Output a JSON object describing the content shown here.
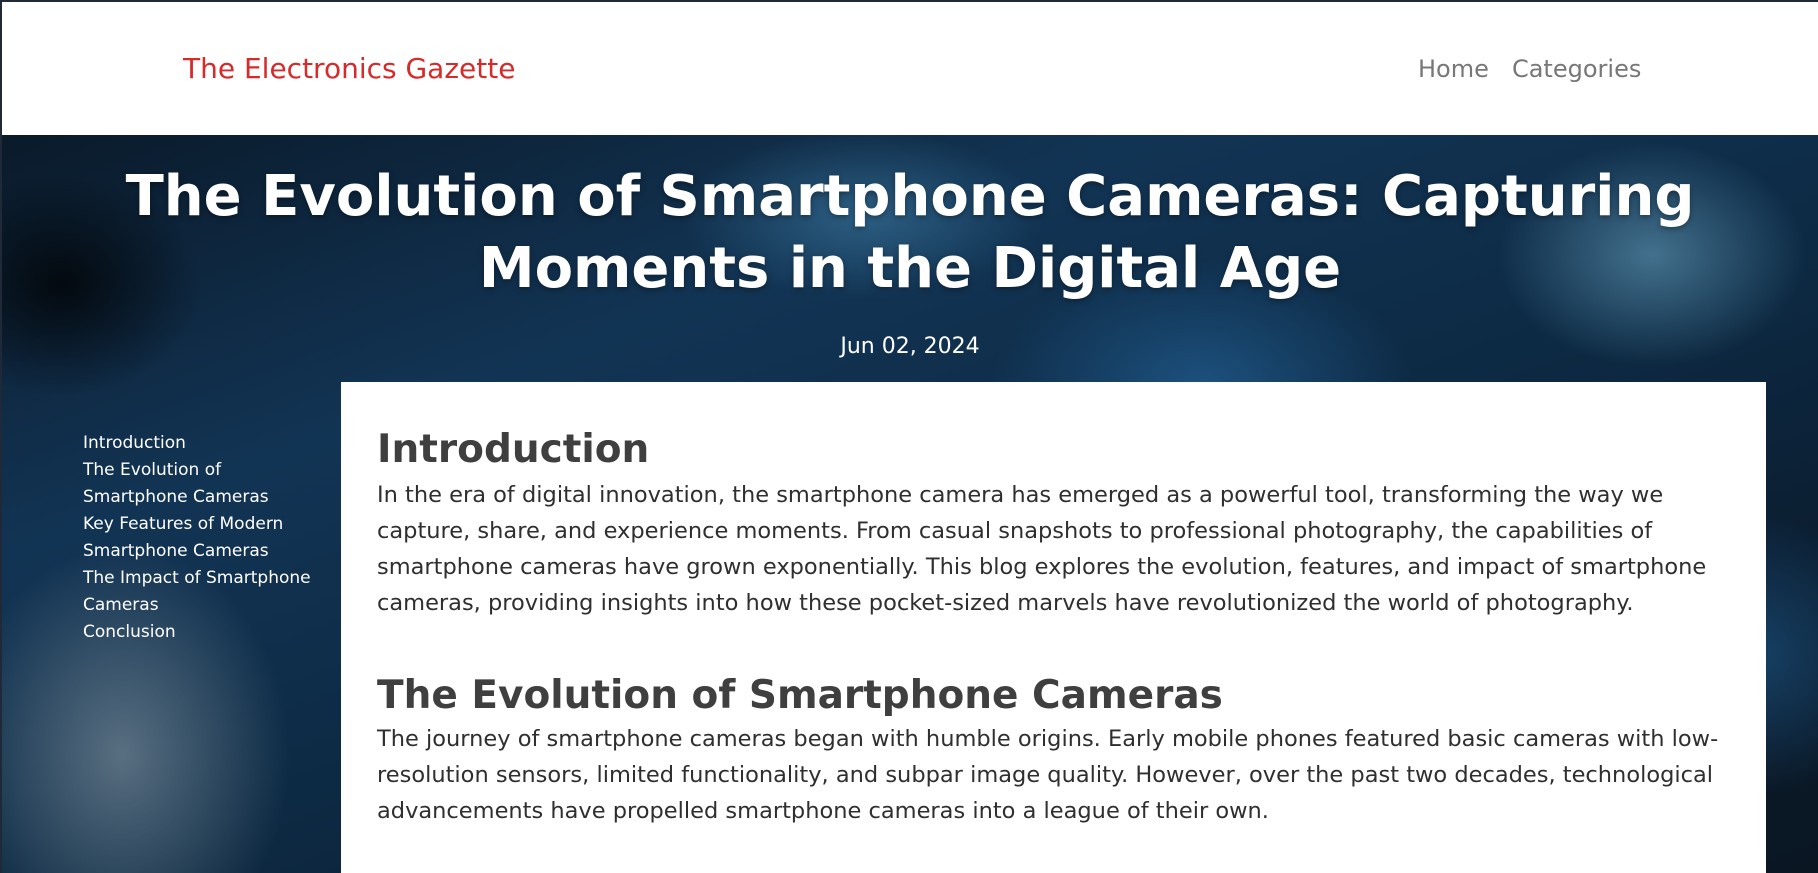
{
  "site": {
    "brand": "The Electronics Gazette",
    "nav": [
      "Home",
      "Categories"
    ]
  },
  "hero": {
    "title": "The Evolution of Smartphone Cameras: Capturing Moments in the Digital Age",
    "date": "Jun 02, 2024"
  },
  "toc": {
    "items": [
      "Introduction",
      "The Evolution of Smartphone Cameras",
      "Key Features of Modern Smartphone Cameras",
      "The Impact of Smartphone Cameras",
      "Conclusion"
    ]
  },
  "article": {
    "sections": [
      {
        "heading": "Introduction",
        "text": "In the era of digital innovation, the smartphone camera has emerged as a powerful tool, transforming the way we capture, share, and experience moments. From casual snapshots to professional photography, the capabilities of smartphone cameras have grown exponentially. This blog explores the evolution, features, and impact of smartphone cameras, providing insights into how these pocket-sized marvels have revolutionized the world of photography."
      },
      {
        "heading": "The Evolution of Smartphone Cameras",
        "text": "The journey of smartphone cameras began with humble origins. Early mobile phones featured basic cameras with low-resolution sensors, limited functionality, and subpar image quality. However, over the past two decades, technological advancements have propelled smartphone cameras into a league of their own."
      }
    ]
  },
  "colors": {
    "brand": "#d62b2b",
    "nav": "#777777",
    "hero_text": "#ffffff"
  }
}
